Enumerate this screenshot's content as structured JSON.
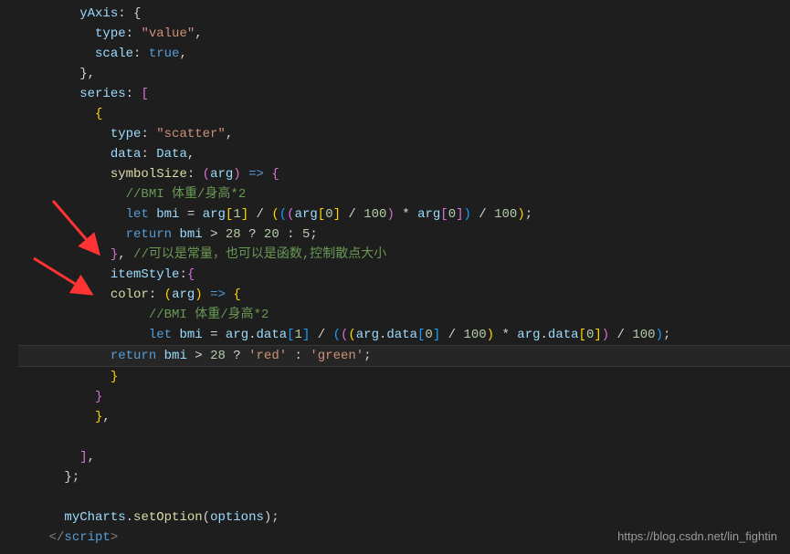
{
  "code": {
    "l1": "        yAxis: {",
    "l2": "          type: \"value\",",
    "l3": "          scale: true,",
    "l4": "        },",
    "l5": "        series: [",
    "l6": "          {",
    "l7": "            type: \"scatter\",",
    "l8": "            data: Data,",
    "l9": "            symbolSize: (arg) => {",
    "l10": "              //BMI 体重/身高*2",
    "l11": "              let bmi = arg[1] / (((arg[0] / 100) * arg[0]) / 100);",
    "l12": "              return bmi > 28 ? 20 : 5;",
    "l13": "            }, //可以是常量，也可以是函数,控制散点大小",
    "l14": "            itemStyle:{",
    "l15": "            color: (arg) => {",
    "l16": "                 //BMI 体重/身高*2",
    "l17": "                 let bmi = arg.data[1] / (((arg.data[0] / 100) * arg.data[0]) / 100);",
    "l18": "            return bmi > 28 ? 'red' : 'green';",
    "l19": "            }",
    "l20": "          }",
    "l21": "          },",
    "l22": "",
    "l23": "        ],",
    "l24": "      };",
    "l25": "",
    "l26": "      myCharts.setOption(options);",
    "l27": "    </script"
  },
  "watermark": "https://blog.csdn.net/lin_fightin"
}
